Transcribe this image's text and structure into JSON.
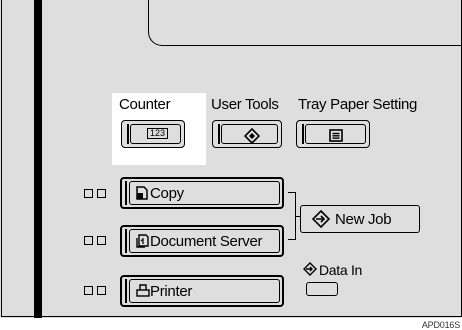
{
  "top_labels": {
    "counter": "Counter",
    "user_tools": "User Tools",
    "tray_paper_setting": "Tray Paper Setting"
  },
  "counter_key": {
    "glyph": "123",
    "icon": "counter-icon"
  },
  "user_tools_key": {
    "icon": "diamond-icon"
  },
  "tray_paper_key": {
    "icon": "list-icon"
  },
  "function_keys": [
    {
      "label": "Copy",
      "icon": "copy-icon"
    },
    {
      "label": "Document Server",
      "icon": "document-server-icon"
    },
    {
      "label": "Printer",
      "icon": "printer-icon"
    }
  ],
  "new_job": {
    "label": "New Job",
    "icon": "new-job-icon"
  },
  "data_in": {
    "label": "Data In",
    "icon": "data-in-icon"
  },
  "figure_code": "APD016S",
  "colors": {
    "panel": "#dedede",
    "highlight": "#ffffff",
    "ink": "#000000"
  }
}
